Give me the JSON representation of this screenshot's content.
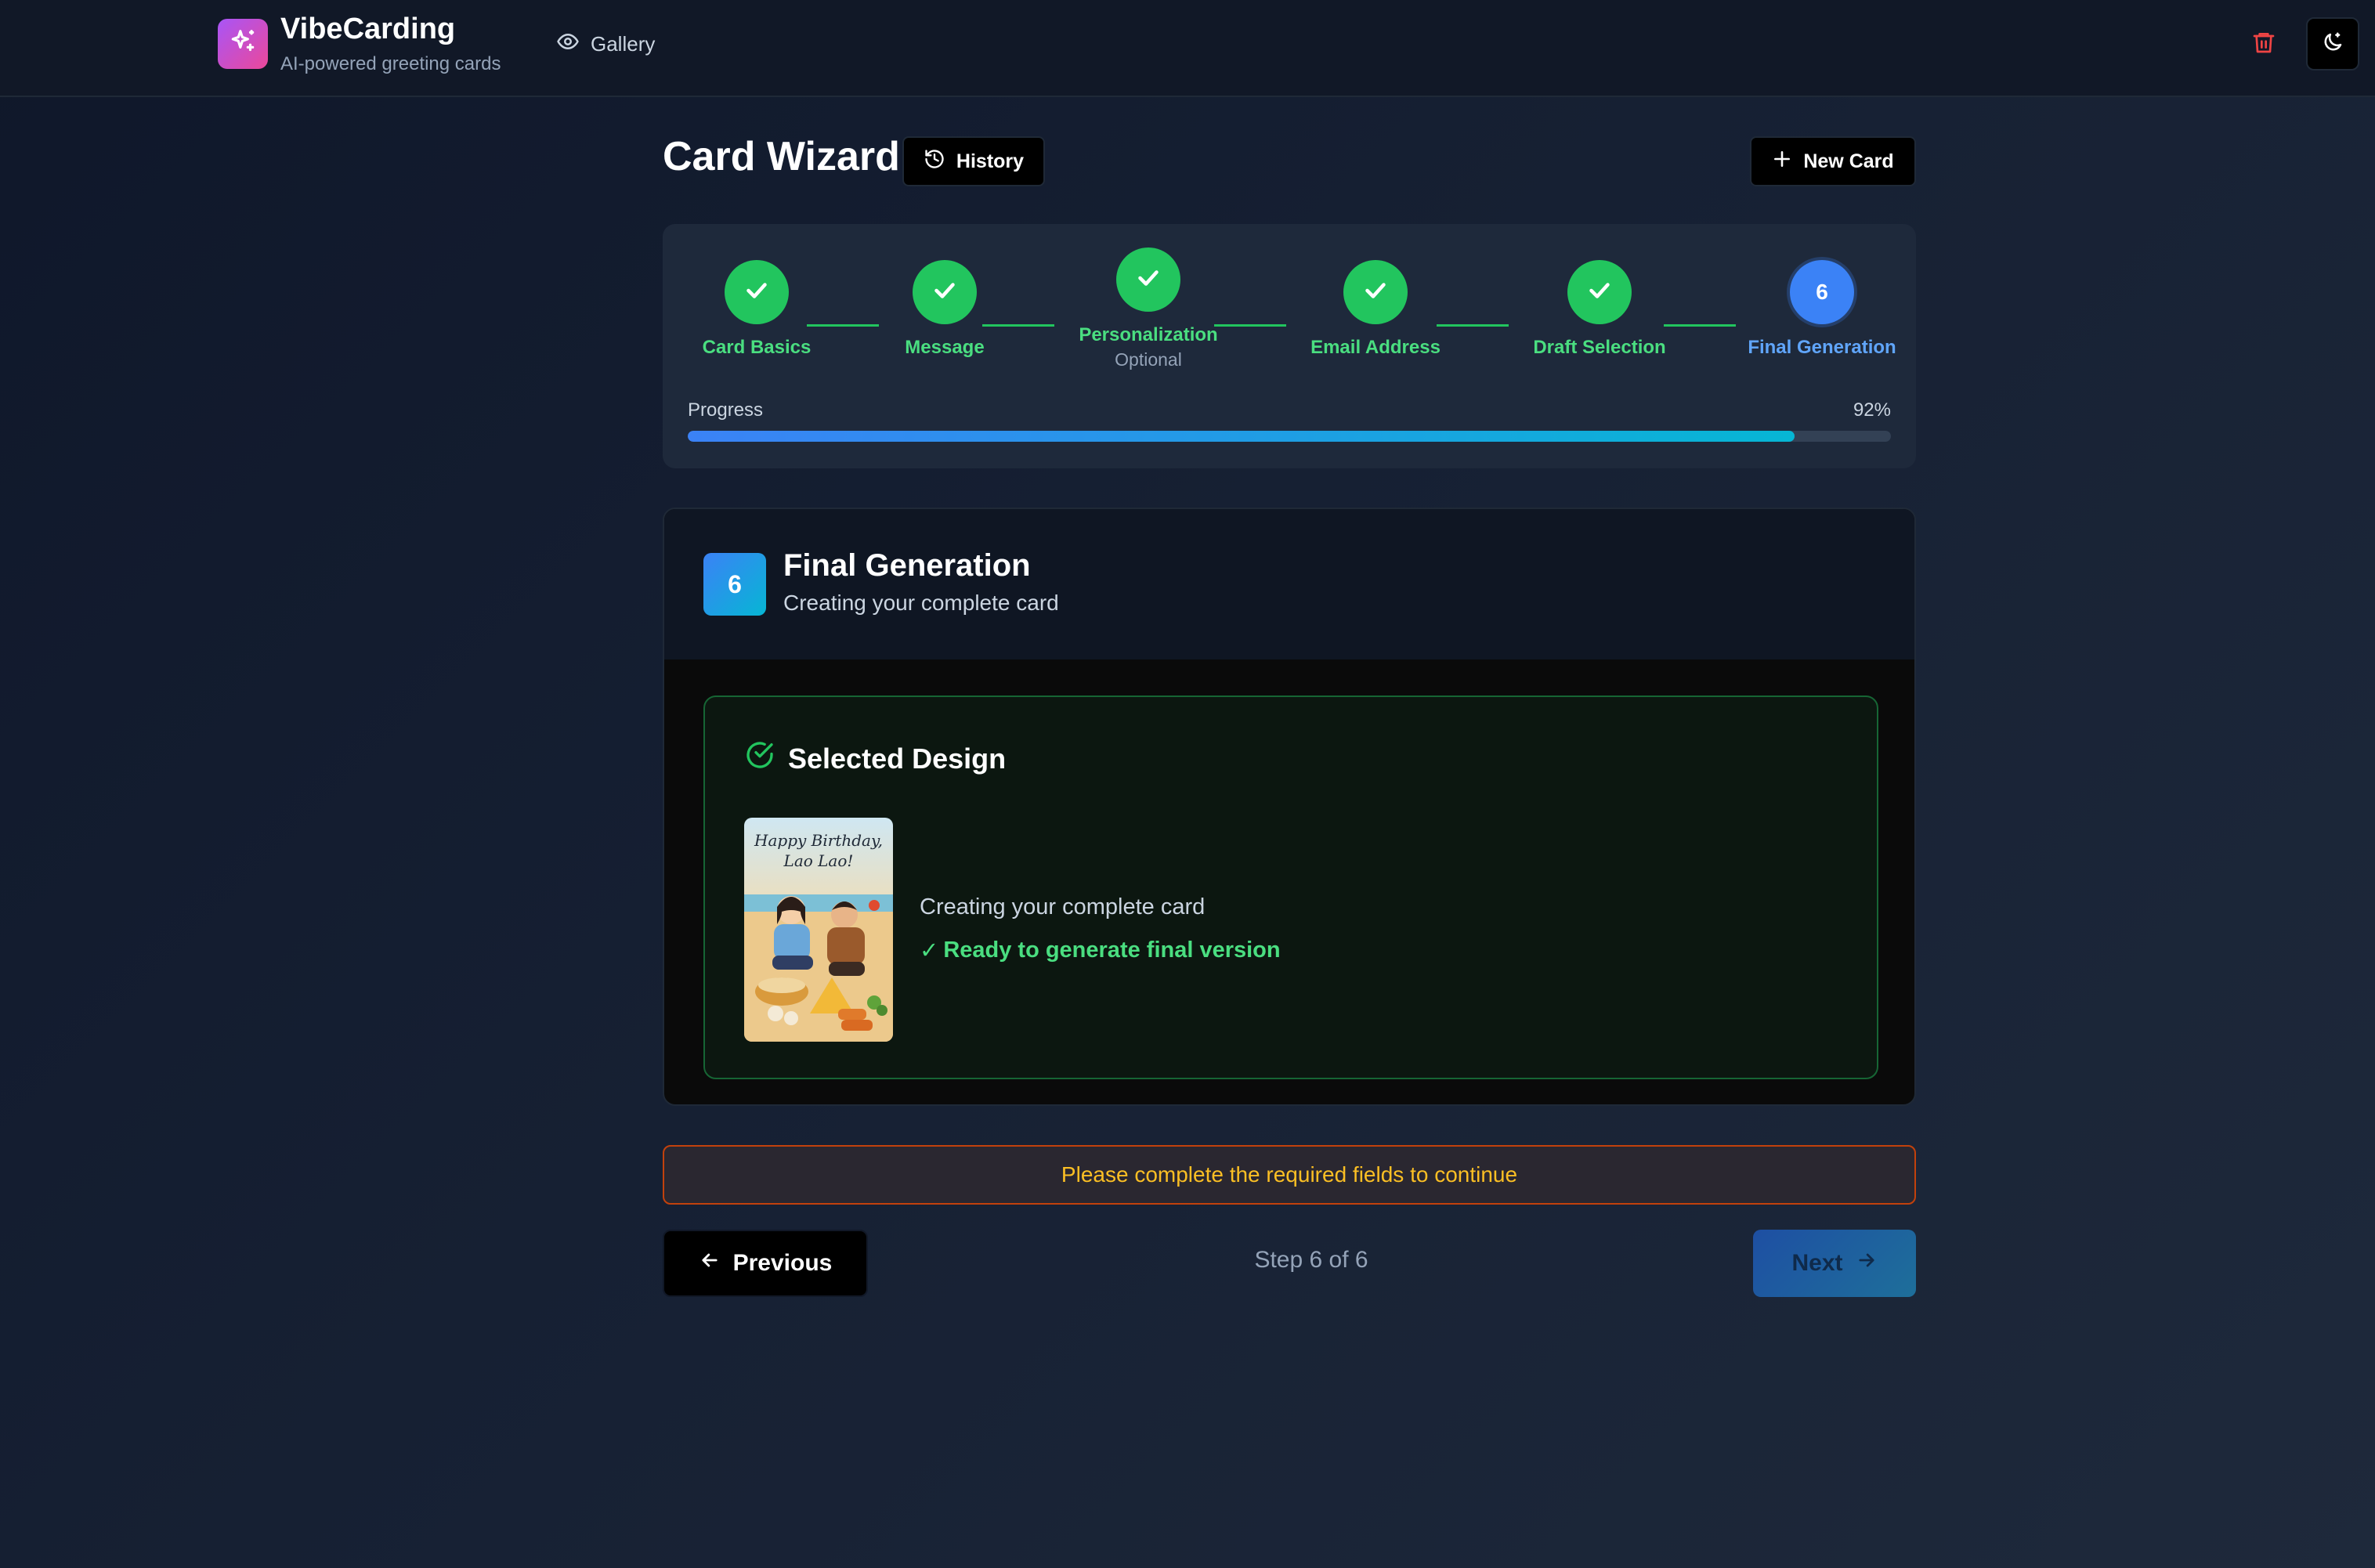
{
  "app": {
    "name": "VibeCarding",
    "tagline": "AI-powered greeting cards",
    "icon": "sparkles-icon"
  },
  "nav": {
    "gallery_label": "Gallery",
    "gallery_icon": "eye-icon",
    "trash_icon": "trash-icon",
    "theme_icon": "moon-icon"
  },
  "header": {
    "title": "Card Wizard",
    "history_label": "History",
    "new_card_label": "New Card"
  },
  "stepper": {
    "steps": [
      {
        "label": "Card Basics",
        "status": "complete"
      },
      {
        "label": "Message",
        "status": "complete"
      },
      {
        "label": "Personalization",
        "sublabel": "Optional",
        "status": "complete"
      },
      {
        "label": "Email Address",
        "status": "complete"
      },
      {
        "label": "Draft Selection",
        "status": "complete"
      },
      {
        "label": "Final Generation",
        "number": "6",
        "status": "active"
      }
    ],
    "progress_label": "Progress",
    "progress_text": "92%",
    "progress_value": 0.92
  },
  "final": {
    "badge": "6",
    "title": "Final Generation",
    "subtitle": "Creating your complete card",
    "selected_title": "Selected Design",
    "description": "Creating your complete card",
    "ready_check": "✓",
    "ready_text": "Ready to generate final version",
    "card_text_line1": "Happy Birthday,",
    "card_text_line2": "Lao Lao!"
  },
  "alert": {
    "message": "Please complete the required fields to continue"
  },
  "footer": {
    "previous_label": "Previous",
    "step_counter": "Step 6 of 6",
    "next_label": "Next"
  },
  "colors": {
    "success": "#22c55e",
    "active": "#3b82f6",
    "warning": "#fbbf24"
  }
}
